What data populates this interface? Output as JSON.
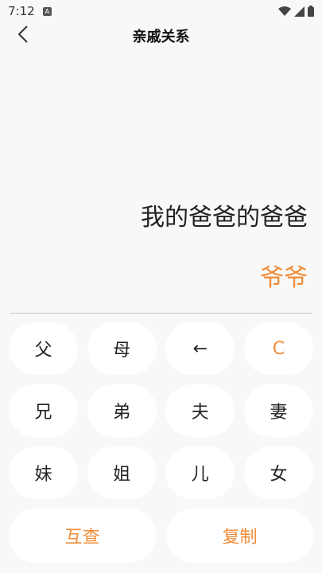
{
  "status_bar": {
    "time": "7:12",
    "app_icon_letter": "A",
    "icons": [
      "wifi-icon",
      "signal-icon",
      "battery-icon"
    ]
  },
  "app_bar": {
    "title": "亲戚关系",
    "back_icon": "chevron-left-icon"
  },
  "display": {
    "expression": "我的爸爸的爸爸",
    "result": "爷爷"
  },
  "keypad": {
    "row1": [
      "父",
      "母",
      "←",
      "C"
    ],
    "row2": [
      "兄",
      "弟",
      "夫",
      "妻"
    ],
    "row3": [
      "妹",
      "姐",
      "儿",
      "女"
    ],
    "row4": [
      "互查",
      "复制"
    ]
  },
  "colors": {
    "accent": "#f28c38",
    "background": "#f8f8f8",
    "key_background": "#ffffff",
    "text": "#222222"
  }
}
